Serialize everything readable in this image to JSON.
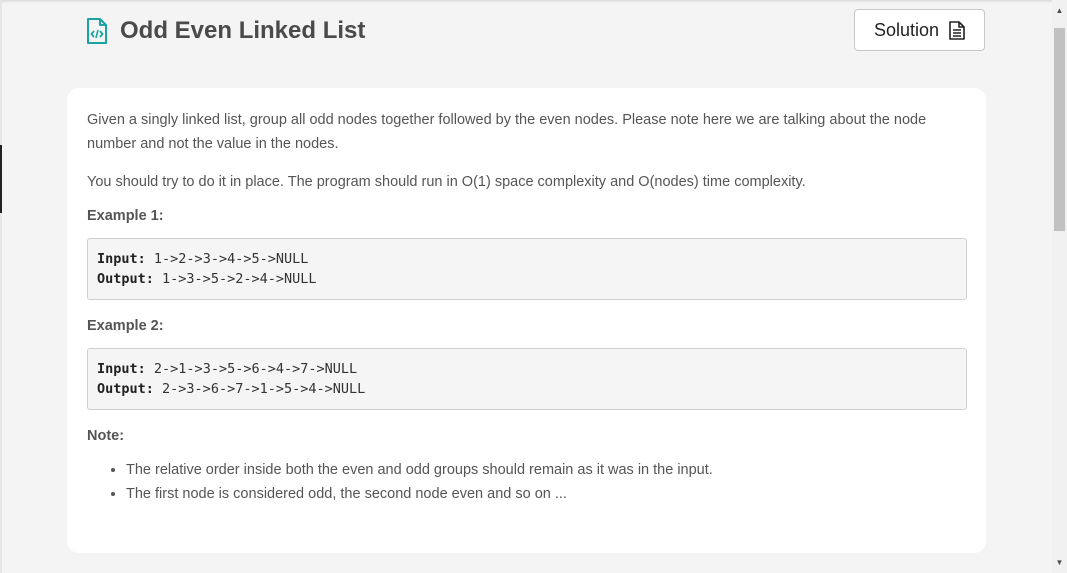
{
  "header": {
    "title": "Odd Even Linked List",
    "solution_label": "Solution"
  },
  "problem": {
    "description": "Given a singly linked list, group all odd nodes together followed by the even nodes. Please note here we are talking about the node number and not the value in the nodes.",
    "constraint": "You should try to do it in place. The program should run in O(1) space complexity and O(nodes) time complexity.",
    "examples": [
      {
        "label": "Example 1:",
        "input_key": "Input:",
        "input": "1->2->3->4->5->NULL",
        "output_key": "Output:",
        "output": "1->3->5->2->4->NULL"
      },
      {
        "label": "Example 2:",
        "input_key": "Input:",
        "input": "2->1->3->5->6->4->7->NULL",
        "output_key": "Output:",
        "output": "2->3->6->7->1->5->4->NULL"
      }
    ],
    "note_label": "Note:",
    "notes": [
      "The relative order inside both the even and odd groups should remain as it was in the input.",
      "The first node is considered odd, the second node even and so on ..."
    ]
  },
  "colors": {
    "accent": "#1aa3a3",
    "page_bg": "#f4f4f4",
    "card_bg": "#ffffff"
  },
  "icons": {
    "title_icon": "code-file-icon",
    "solution_icon": "document-icon"
  }
}
